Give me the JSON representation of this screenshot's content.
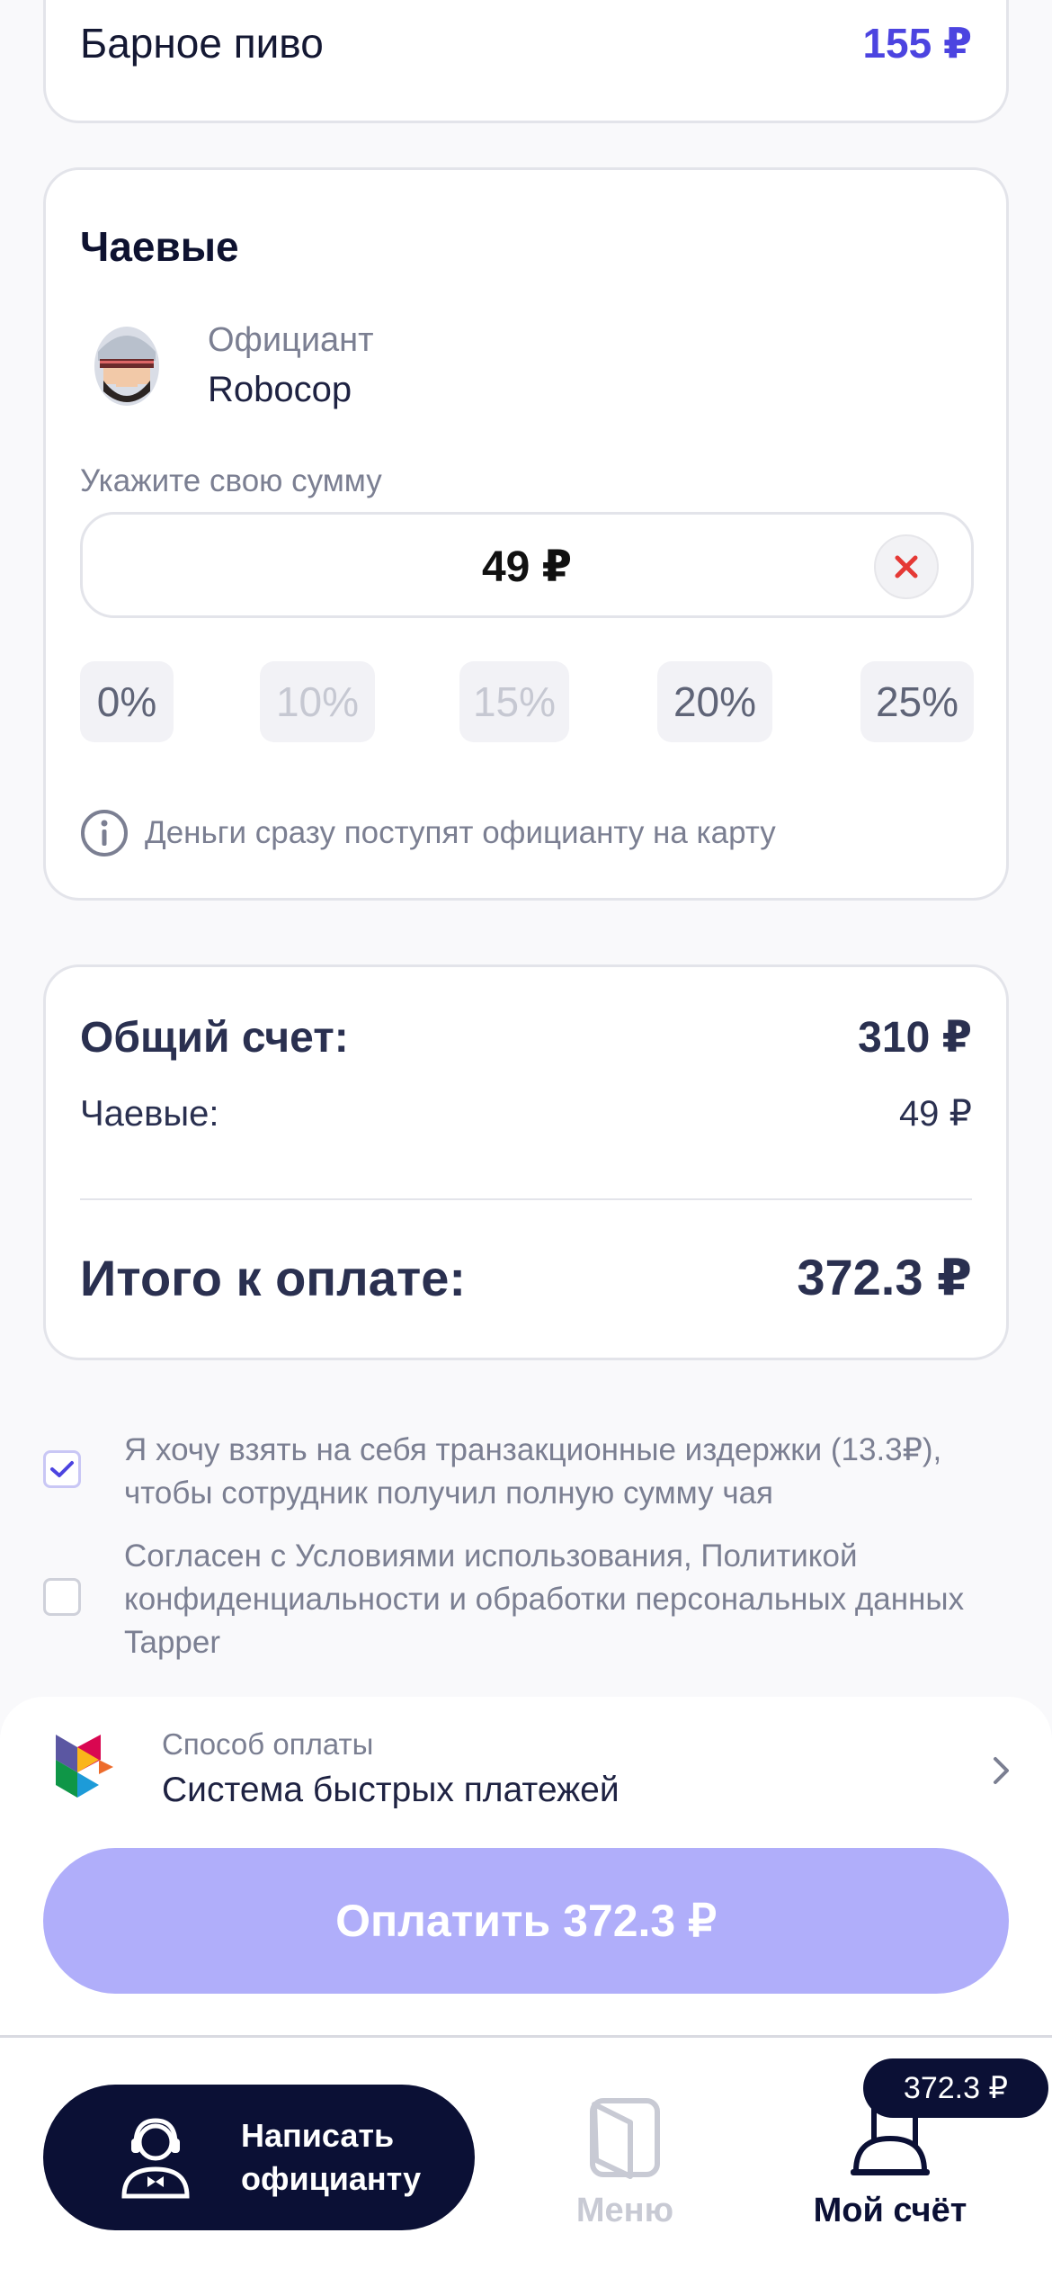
{
  "top_item": {
    "name": "Барное пиво",
    "price": "155 ₽"
  },
  "tips": {
    "title": "Чаевые",
    "waiter_role": "Официант",
    "waiter_name": "Robocop",
    "amount_label": "Укажите свою сумму",
    "amount_value": "49 ₽",
    "percent_options": [
      "0%",
      "10%",
      "15%",
      "20%",
      "25%"
    ],
    "info_text": "Деньги сразу поступят официанту на карту"
  },
  "summary": {
    "total_label": "Общий счет:",
    "total_value": "310 ₽",
    "tips_label": "Чаевые:",
    "tips_value": "49 ₽",
    "grand_label": "Итого к оплате:",
    "grand_value": "372.3 ₽"
  },
  "checkboxes": {
    "fees_text": "Я хочу взять на себя транзакционные издержки (13.3₽), чтобы сотрудник получил полную сумму чая",
    "fees_checked": true,
    "terms_text": "Согласен с Условиями использования, Политикой конфиденциальности и обработки персональных данных Tapper",
    "terms_checked": false
  },
  "payment": {
    "method_label": "Способ оплаты",
    "method_name": "Система быстрых платежей",
    "pay_button": "Оплатить 372.3 ₽"
  },
  "nav": {
    "write_waiter": "Написать официанту",
    "menu": "Меню",
    "my_bill": "Мой счёт",
    "bill_badge": "372.3 ₽"
  },
  "colors": {
    "accent": "#4c44e0",
    "pay_button": "#b0aefa",
    "dark_navy": "#0b1035",
    "error_x": "#e53935"
  }
}
